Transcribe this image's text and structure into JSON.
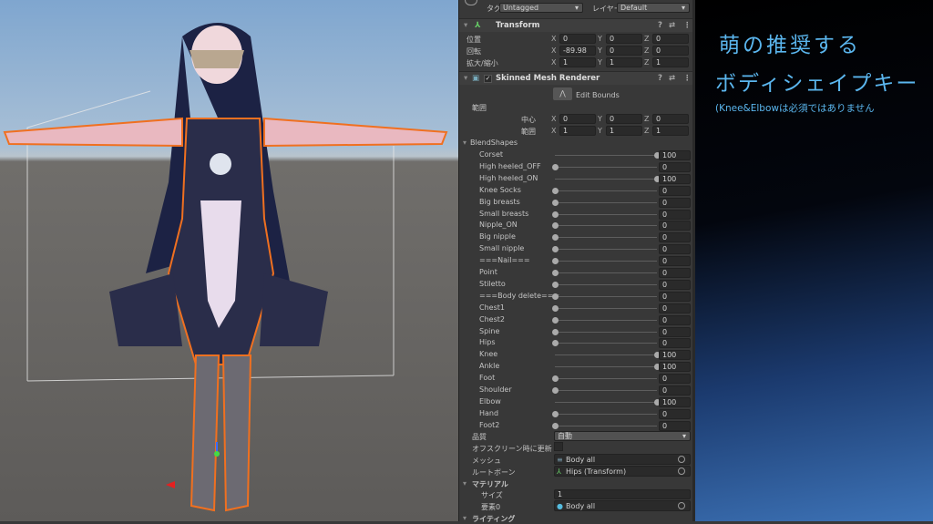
{
  "header": {
    "tag_label": "タグ",
    "tag_value": "Untagged",
    "layer_label": "レイヤー",
    "layer_value": "Default"
  },
  "transform": {
    "title": "Transform",
    "rows": [
      {
        "label": "位置",
        "x": "0",
        "y": "0",
        "z": "0"
      },
      {
        "label": "回転",
        "x": "-89.98",
        "y": "0",
        "z": "0"
      },
      {
        "label": "拡大/縮小",
        "x": "1",
        "y": "1",
        "z": "1"
      }
    ]
  },
  "smr": {
    "title": "Skinned Mesh Renderer",
    "edit_bounds": "Edit Bounds",
    "bounds_label": "範囲",
    "bounds": [
      {
        "label": "中心",
        "x": "0",
        "y": "0",
        "z": "0"
      },
      {
        "label": "範囲",
        "x": "1",
        "y": "1",
        "z": "1"
      }
    ],
    "blendshapes_label": "BlendShapes",
    "blendshapes": [
      {
        "name": "Corset",
        "value": 100
      },
      {
        "name": "High heeled_OFF",
        "value": 0
      },
      {
        "name": "High heeled_ON",
        "value": 100
      },
      {
        "name": "Knee Socks",
        "value": 0
      },
      {
        "name": "Big breasts",
        "value": 0
      },
      {
        "name": "Small breasts",
        "value": 0
      },
      {
        "name": "Nipple_ON",
        "value": 0
      },
      {
        "name": "Big nipple",
        "value": 0
      },
      {
        "name": "Small nipple",
        "value": 0
      },
      {
        "name": "===Nail===",
        "value": 0
      },
      {
        "name": "Point",
        "value": 0
      },
      {
        "name": "Stiletto",
        "value": 0
      },
      {
        "name": "===Body delete===",
        "value": 0
      },
      {
        "name": "Chest1",
        "value": 0
      },
      {
        "name": "Chest2",
        "value": 0
      },
      {
        "name": "Spine",
        "value": 0
      },
      {
        "name": "Hips",
        "value": 0
      },
      {
        "name": "Knee",
        "value": 100
      },
      {
        "name": "Ankle",
        "value": 100
      },
      {
        "name": "Foot",
        "value": 0
      },
      {
        "name": "Shoulder",
        "value": 0
      },
      {
        "name": "Elbow",
        "value": 100
      },
      {
        "name": "Hand",
        "value": 0
      },
      {
        "name": "Foot2",
        "value": 0
      }
    ],
    "quality_label": "品質",
    "quality_value": "自動",
    "offscreen_label": "オフスクリーン時に更新",
    "mesh_label": "メッシュ",
    "mesh_value": "Body all",
    "rootbone_label": "ルートボーン",
    "rootbone_value": "Hips (Transform)",
    "materials_label": "マテリアル",
    "size_label": "サイズ",
    "size_value": "1",
    "element0_label": "要素0",
    "element0_value": "Body all",
    "lighting_label": "ライティング"
  },
  "annotation": {
    "line1": "萌の推奨する",
    "line2": "ボディシェイプキー",
    "line3": "(Knee&Elbowは必須ではありません",
    "color": "#5bb6ee"
  }
}
